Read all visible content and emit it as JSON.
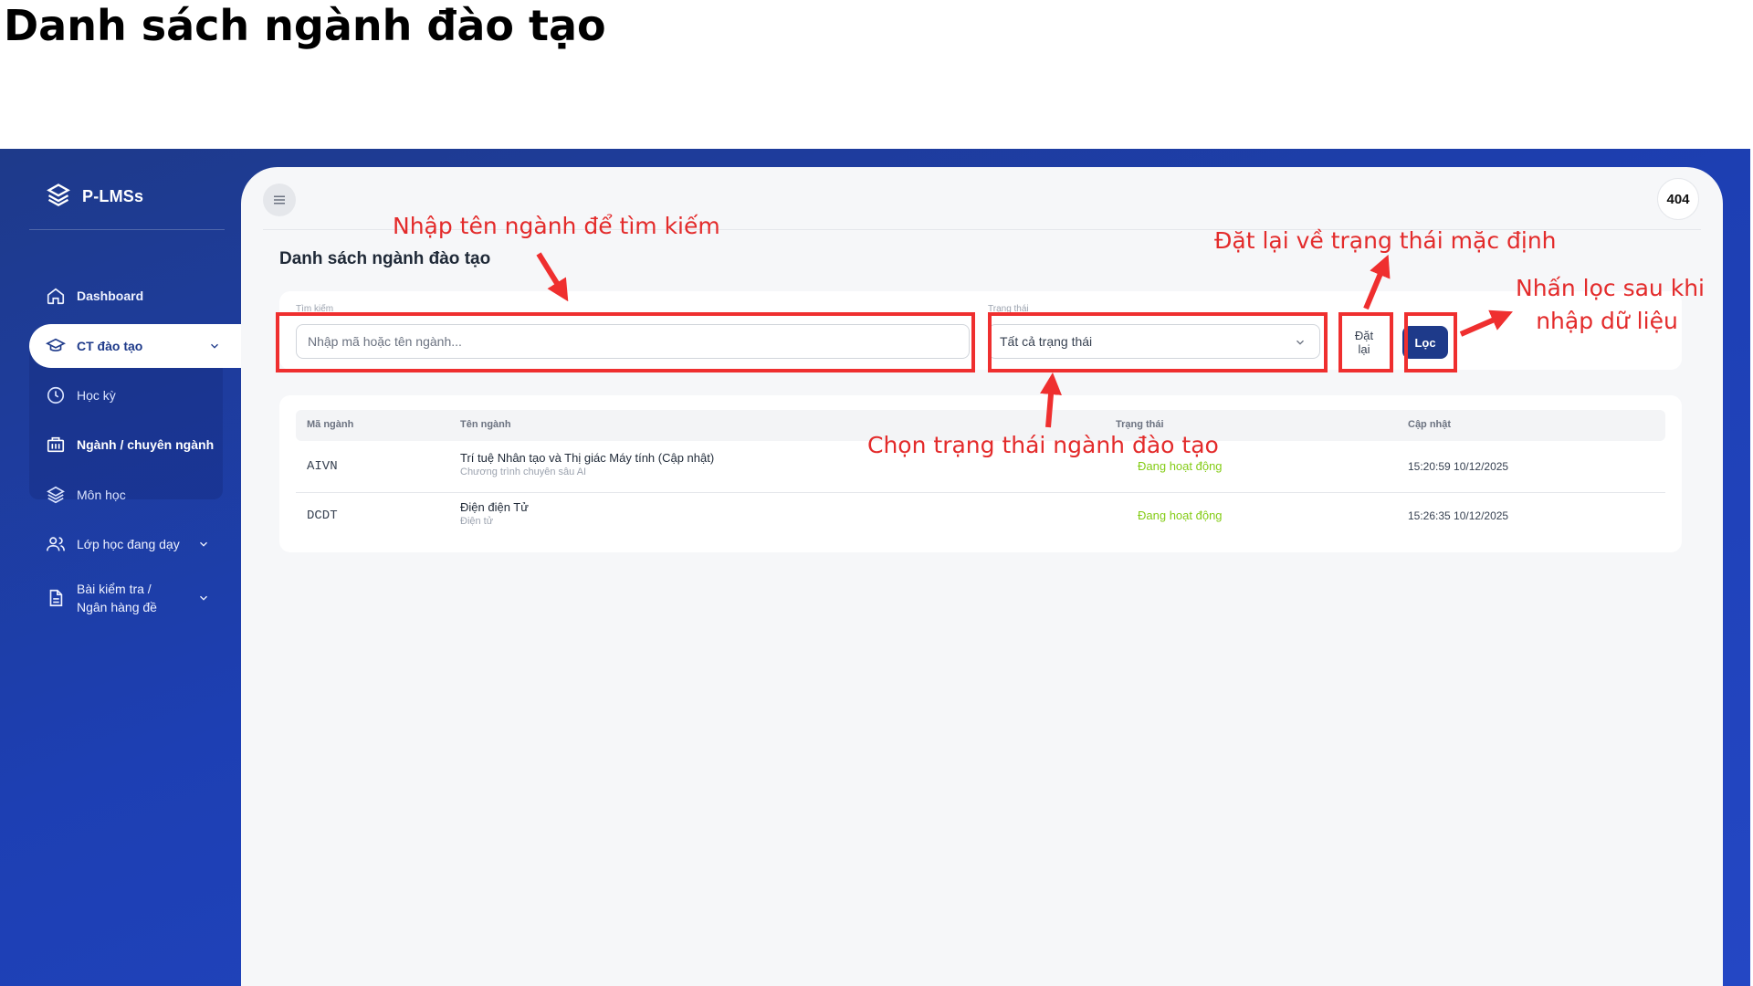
{
  "page_heading": "Danh sách ngành đào tạo",
  "app": {
    "brand": "P-LMSs",
    "avatar_text": "404"
  },
  "sidebar": {
    "items": [
      {
        "label": "Dashboard",
        "icon": "home-icon"
      },
      {
        "label": "CT đào tạo",
        "icon": "graduation-cap-icon",
        "active": true
      },
      {
        "label": "Học kỳ",
        "icon": "clock-icon"
      },
      {
        "label": "Ngành / chuyên ngành",
        "icon": "building-icon"
      },
      {
        "label": "Môn học",
        "icon": "layers-icon"
      },
      {
        "label": "Lớp học đang dạy",
        "icon": "users-icon"
      },
      {
        "label_line1": "Bài kiểm tra /",
        "label_line2": "Ngân hàng đề",
        "icon": "document-icon"
      }
    ]
  },
  "main": {
    "title": "Danh sách ngành đào tạo",
    "filter": {
      "search_label": "Tìm kiếm",
      "search_placeholder": "Nhập mã hoặc tên ngành...",
      "status_label": "Trạng thái",
      "status_value": "Tất cả trạng thái",
      "reset_label": "Đặt lại",
      "filter_label": "Lọc"
    },
    "table": {
      "headers": [
        "Mã ngành",
        "Tên ngành",
        "Trạng thái",
        "Cập nhật"
      ],
      "rows": [
        {
          "code": "AIVN",
          "name": "Trí tuệ Nhân tạo và Thị giác Máy tính (Cập nhật)",
          "description": "Chương trình chuyên sâu AI",
          "status": "Đang hoạt động",
          "updated": "15:20:59 10/12/2025"
        },
        {
          "code": "DCDT",
          "name": "Điện điện Tử",
          "description": "Điện tử",
          "status": "Đang hoạt động",
          "updated": "15:26:35 10/12/2025"
        }
      ]
    }
  },
  "annotations": {
    "search_hint": "Nhập tên ngành để tìm kiếm",
    "reset_hint": "Đặt lại về trạng thái mặc định",
    "filter_hint_line1": "Nhấn lọc sau khi",
    "filter_hint_line2": "nhập dữ liệu",
    "status_hint": "Chọn trạng thái ngành đào tạo"
  },
  "colors": {
    "sidebar_bg": "#1e3a8a",
    "accent": "#1e3a8a",
    "status_active": "#84cc16",
    "annotation": "#ef2f2f"
  }
}
